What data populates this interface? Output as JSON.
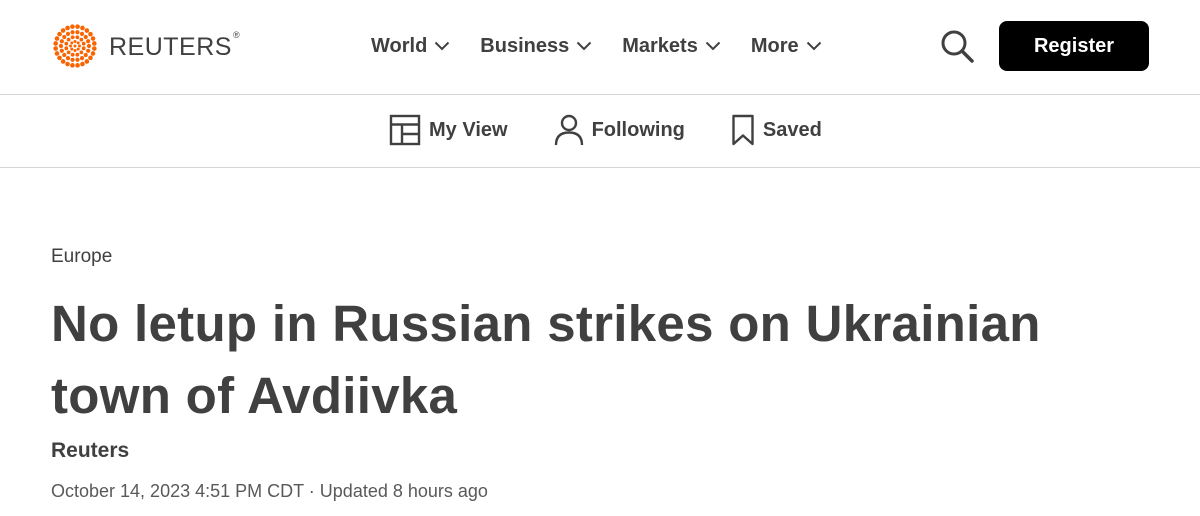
{
  "header": {
    "logo_text": "REUTERS",
    "logo_mark": "®",
    "nav": [
      {
        "label": "World"
      },
      {
        "label": "Business"
      },
      {
        "label": "Markets"
      },
      {
        "label": "More"
      }
    ],
    "search_icon": "search-icon",
    "register_label": "Register"
  },
  "subnav": [
    {
      "label": "My View",
      "icon": "layout-icon"
    },
    {
      "label": "Following",
      "icon": "person-icon"
    },
    {
      "label": "Saved",
      "icon": "bookmark-icon"
    }
  ],
  "article": {
    "section": "Europe",
    "headline": "No letup in Russian strikes on Ukrainian town of Avdiivka",
    "author": "Reuters",
    "dateline": "October 14, 2023 4:51 PM CDT · Updated 8 hours ago"
  },
  "colors": {
    "brand_orange": "#fa6400",
    "text": "#404040",
    "button_bg": "#000000",
    "button_text": "#ffffff",
    "divider": "#d4d4d4"
  }
}
